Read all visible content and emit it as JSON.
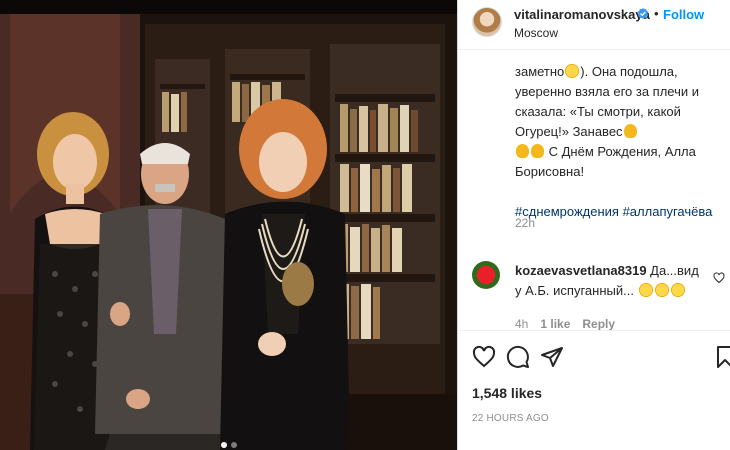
{
  "post": {
    "username": "vitalinaromanovskaya",
    "follow_separator": "•",
    "follow_label": "Follow",
    "location": "Moscow"
  },
  "caption": {
    "line1_pre": "заметно",
    "line1_post": "). Она подошла, уверенно взяла его за плечи и сказала: «Ты смотри, какой Огурец!» Занавес",
    "line2": " С Днём Рождения, Алла Борисовна!",
    "hashtags": "#сднемрождения #аллапугачёва",
    "time": "22h"
  },
  "comment": {
    "username": "kozaevasvetlana8319",
    "text": " Да...вид у А.Б. испуганный...",
    "time": "4h",
    "likes": "1 like",
    "reply": "Reply"
  },
  "footer": {
    "likes": "1,548 likes",
    "time": "22 hours ago"
  },
  "icons": {
    "verified": "verified-badge-icon",
    "like": "heart-icon",
    "comment": "comment-icon",
    "share": "paper-plane-icon",
    "save": "bookmark-icon"
  },
  "colors": {
    "link": "#0095f6",
    "hashtag": "#00376b",
    "secondary_text": "#8e8e8e"
  }
}
